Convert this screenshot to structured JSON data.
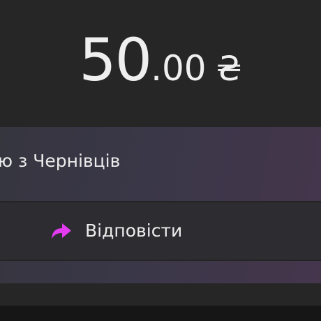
{
  "donation": {
    "amount_integer": "50",
    "amount_decimal": ".00",
    "currency_symbol": "₴"
  },
  "message": {
    "text": "ю з Чернівців"
  },
  "actions": {
    "reply_label": "Відповісти",
    "reply_icon": "reply-arrow-icon",
    "reply_icon_color": "#e23bf0"
  },
  "colors": {
    "background": "#262626",
    "card_gradient_start": "#36363f",
    "card_gradient_end": "#45364c",
    "reply_row": "#2d2c31"
  }
}
